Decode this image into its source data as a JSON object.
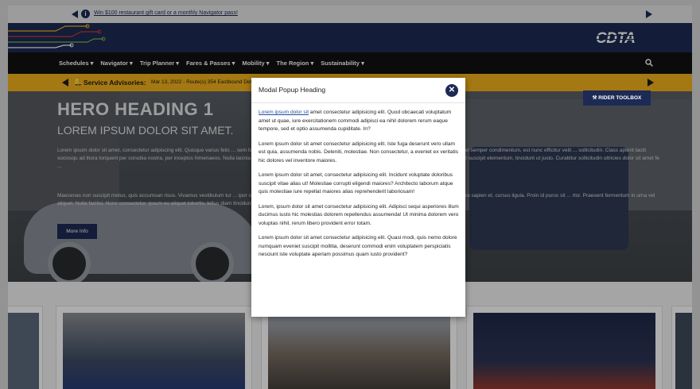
{
  "promo": {
    "text": "Win $100 restaurant gift card or a monthly Navigator pass!"
  },
  "brand": {
    "logo_text": "CDTA"
  },
  "nav": {
    "items": [
      "Schedules ▾",
      "Navigator ▾",
      "Trip Planner ▾",
      "Fares & Passes ▾",
      "Mobility ▾",
      "The Region ▾",
      "Sustainability ▾"
    ]
  },
  "advisory": {
    "label": "Service Advisories:",
    "text": "Mar 13, 2022 - Route(s) 354 Eastbound Detour due to Police activity"
  },
  "hero": {
    "heading": "HERO HEADING 1",
    "subheading": "LOREM IPSUM DOLOR SIT AMET.",
    "paragraph1": "Lorem ipsum dolor sit amet, consectetur adipiscing elit. Quisque varius felis ... sem faucibus. Etiam ullamcorper velit at arcu aliquam, eget ultrices ex dictum. Cras dictum, metus vel semper condimentum, est nunc efficitur velit ... sollicitudin. Class aptent taciti sociosqu ad litora torquent per conubia nostra, per inceptos himenaeos. Nulla lacinia nec ipsum nec interdum. Susp ... quis id arcu cursus commodo. Proin nullis risus, porttitor sed suscipit elementum, tincidunt ut justo. Curabitur sollicitudin ultricies dolor sit amet fe ...",
    "paragraph2": "Maecenas non suscipit metus, quis accumsan risus. Vivamus vestibulum tur ... ipor sagittis viverra. Aliquam ullamcorper massa sed egestas mollis. Duis sed nulla bibendum, viverra sapien et, cursus ligula. Proin id purus sit ... rtor. Praesent fermentum in urna vel aliquet. Nulla facilisi. Nunc consectetur, ipsum eu aliquet lobortis, tellus diam tincidunt justo, sit amet co ... ero. Duis et mollis lectus, quis auctor nisi.",
    "more_button": "More Info",
    "toolbox_button": "⚒ RIDER TOOLBOX"
  },
  "modal": {
    "title": "Modal Popup Heading",
    "close_symbol": "✕",
    "p1_link": "Lorem ipsum dolor sit",
    "p1_rest": " amet consectetur adipisicing elit. Quod obcaecati voluptatum amet ut quae, iure exercitationem commodi adipisci ea nihil dolorem rerum eaque tempore, sed et optio assumenda cupiditate. In?",
    "p2": "Lorem ipsum dolor sit amet consectetur adipisicing elit. Iste fuga deserunt vero ullam est quia, assumenda nobis. Deleniti, molestiae. Non consectetur, a eveniet ex veritatis hic dolores vel inventore maiores.",
    "p3": "Lorem ipsum dolor sit amet, consectetur adipisicing elit. Incidunt voluptate doloribus suscipit vitae alias ut! Molestiae corrupti eligendi maiores? Architecto laborum atque quis molestiae iure repellat maiores alias reprehenderit laboriosam!",
    "p4": "Lorem, ipsum dolor sit amet consectetur adipisicing elit. Adipisci sequi asperiores illum ducimus iusto hic molestias dolorem repellendus assumenda! Ut minima dolorem vero voluptas nihil, rerum libero provident error totam.",
    "p5": "Lorem ipsum dolor sit amet consectetur adipisicing elit. Quasi modi, quis nemo dolore numquam eveniet suscipit mollitia, deserunt commodi enim voluptatem perspiciatis nesciunt iste voluptate aperiam possimus quam iusto provident?"
  },
  "colors": {
    "navy": "#1c2a55",
    "advisory_yellow": "#f2b21b",
    "nav_black": "#111111"
  }
}
